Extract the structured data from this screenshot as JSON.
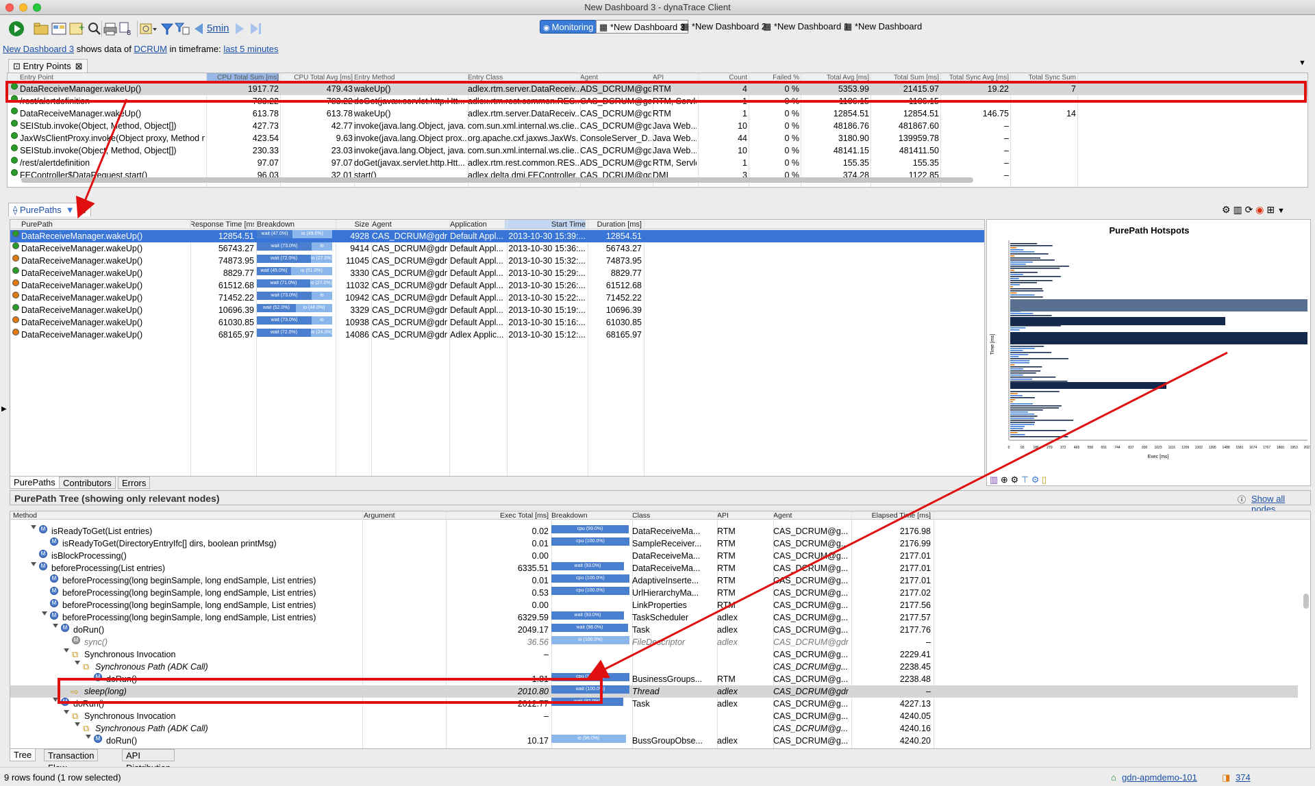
{
  "window": {
    "title": "New Dashboard 3 - dynaTrace Client"
  },
  "toolbar": {
    "time_label": "5min",
    "monitoring": "Monitoring",
    "dash_tabs": [
      "*New Dashboard 3",
      "*New Dashboard 2",
      "*New Dashboard 1",
      "*New Dashboard"
    ]
  },
  "info": {
    "dashboard": "New Dashboard 3",
    "shows": "shows data of",
    "source": "DCRUM",
    "in_tf": "in timeframe:",
    "timeframe": "last 5 minutes"
  },
  "entry_points": {
    "tab": "Entry Points",
    "columns": [
      "Entry Point",
      "CPU Total Sum [ms]",
      "CPU Total Avg [ms]",
      "Entry Method",
      "Entry Class",
      "Agent",
      "API",
      "Count",
      "Failed %",
      "Total Avg [ms]",
      "Total Sum [ms]",
      "Total Sync Avg [ms]",
      "Total Sync Sum"
    ],
    "rows": [
      [
        "DataReceiveManager.wakeUp()",
        "1917.72",
        "479.43",
        "wakeUp()",
        "adlex.rtm.server.DataReceiv...",
        "ADS_DCRUM@gd...",
        "RTM",
        "4",
        "0 %",
        "5353.99",
        "21415.97",
        "19.22",
        "7"
      ],
      [
        "/rest/alertdefinition",
        "783.22",
        "783.22",
        "doGet(javax.servlet.http.Htt...",
        "adlex.rtm.rest.common.RES...",
        "CAS_DCRUM@gd...",
        "RTM, Servlet",
        "1",
        "0 %",
        "1106.15",
        "1106.15",
        "–",
        ""
      ],
      [
        "DataReceiveManager.wakeUp()",
        "613.78",
        "613.78",
        "wakeUp()",
        "adlex.rtm.server.DataReceiv...",
        "CAS_DCRUM@gd...",
        "RTM",
        "1",
        "0 %",
        "12854.51",
        "12854.51",
        "146.75",
        "14"
      ],
      [
        "SEIStub.invoke(Object, Method, Object[])",
        "427.73",
        "42.77",
        "invoke(java.lang.Object, java....",
        "com.sun.xml.internal.ws.clie...",
        "CAS_DCRUM@gd...",
        "Java Web...",
        "10",
        "0 %",
        "48186.76",
        "481867.60",
        "–",
        ""
      ],
      [
        "JaxWsClientProxy.invoke(Object proxy, Method m...",
        "423.54",
        "9.63",
        "invoke(java.lang.Object prox...",
        "org.apache.cxf.jaxws.JaxWs...",
        "ConsoleServer_D...",
        "Java Web...",
        "44",
        "0 %",
        "3180.90",
        "139959.78",
        "–",
        ""
      ],
      [
        "SEIStub.invoke(Object, Method, Object[])",
        "230.33",
        "23.03",
        "invoke(java.lang.Object, java....",
        "com.sun.xml.internal.ws.clie...",
        "CAS_DCRUM@gd...",
        "Java Web...",
        "10",
        "0 %",
        "48141.15",
        "481411.50",
        "–",
        ""
      ],
      [
        "/rest/alertdefinition",
        "97.07",
        "97.07",
        "doGet(javax.servlet.http.Htt...",
        "adlex.rtm.rest.common.RES...",
        "ADS_DCRUM@gd...",
        "RTM, Servlet",
        "1",
        "0 %",
        "155.35",
        "155.35",
        "–",
        ""
      ],
      [
        "FEController$DataRequest.start()",
        "96.03",
        "32.01",
        "start()",
        "adlex.delta.dmi.FEController...",
        "CAS_DCRUM@gd...",
        "DMI",
        "3",
        "0 %",
        "374.28",
        "1122.85",
        "–",
        ""
      ]
    ]
  },
  "purepaths": {
    "tab": "PurePaths",
    "columns": [
      "PurePath",
      "Response Time [ms]",
      "Breakdown",
      "Size",
      "Agent",
      "Application",
      "Start Time",
      "Duration [ms]"
    ],
    "rows": [
      {
        "name": "DataReceiveManager.wakeUp()",
        "rt": "12854.51",
        "b1": "wait (47.0%)",
        "b2": "io (49.0%)",
        "size": "4928",
        "agent": "CAS_DCRUM@gdn-...",
        "app": "Default Appl...",
        "start": "2013-10-30 15:39:...",
        "dur": "12854.51",
        "color": "#2a9a2a"
      },
      {
        "name": "DataReceiveManager.wakeUp()",
        "rt": "56743.27",
        "b1": "wait (73.0%)",
        "b2": "io",
        "size": "9414",
        "agent": "CAS_DCRUM@gdn-...",
        "app": "Default Appl...",
        "start": "2013-10-30 15:36:...",
        "dur": "56743.27",
        "color": "#2a9a2a"
      },
      {
        "name": "DataReceiveManager.wakeUp()",
        "rt": "74873.95",
        "b1": "wait (72.0%)",
        "b2": "io (27.0%)",
        "size": "11045",
        "agent": "CAS_DCRUM@gdn-...",
        "app": "Default Appl...",
        "start": "2013-10-30 15:32:...",
        "dur": "74873.95",
        "color": "#e07a10"
      },
      {
        "name": "DataReceiveManager.wakeUp()",
        "rt": "8829.77",
        "b1": "wait (45.0%)",
        "b2": "io (51.0%)",
        "size": "3330",
        "agent": "CAS_DCRUM@gdn-...",
        "app": "Default Appl...",
        "start": "2013-10-30 15:29:...",
        "dur": "8829.77",
        "color": "#2a9a2a"
      },
      {
        "name": "DataReceiveManager.wakeUp()",
        "rt": "61512.68",
        "b1": "wait (71.0%)",
        "b2": "io (27.0%)",
        "size": "11032",
        "agent": "CAS_DCRUM@gdn-...",
        "app": "Default Appl...",
        "start": "2013-10-30 15:26:...",
        "dur": "61512.68",
        "color": "#e07a10"
      },
      {
        "name": "DataReceiveManager.wakeUp()",
        "rt": "71452.22",
        "b1": "wait (73.0%)",
        "b2": "io",
        "size": "10942",
        "agent": "CAS_DCRUM@gdn-...",
        "app": "Default Appl...",
        "start": "2013-10-30 15:22:...",
        "dur": "71452.22",
        "color": "#e07a10"
      },
      {
        "name": "DataReceiveManager.wakeUp()",
        "rt": "10696.39",
        "b1": "wait (52.0%)",
        "b2": "io (44.0%)",
        "size": "3329",
        "agent": "CAS_DCRUM@gdn-...",
        "app": "Default Appl...",
        "start": "2013-10-30 15:19:...",
        "dur": "10696.39",
        "color": "#2a9a2a"
      },
      {
        "name": "DataReceiveManager.wakeUp()",
        "rt": "61030.85",
        "b1": "wait (73.0%)",
        "b2": "io",
        "size": "10938",
        "agent": "CAS_DCRUM@gdn-...",
        "app": "Default Appl...",
        "start": "2013-10-30 15:16:...",
        "dur": "61030.85",
        "color": "#e07a10"
      },
      {
        "name": "DataReceiveManager.wakeUp()",
        "rt": "68165.97",
        "b1": "wait (72.0%)",
        "b2": "io (24.0%)",
        "size": "14086",
        "agent": "CAS_DCRUM@gdn-...",
        "app": "Adlex Applic...",
        "start": "2013-10-30 15:12:...",
        "dur": "68165.97",
        "color": "#e07a10"
      }
    ],
    "subtabs": [
      "PurePaths",
      "Contributors",
      "Errors"
    ]
  },
  "hotspots": {
    "title": "PurePath Hotspots",
    "ylabel": "Time [ms]",
    "xlabel": "Exec [ms]",
    "xticks": [
      "0",
      "93",
      "186",
      "279",
      "372",
      "465",
      "558",
      "651",
      "744",
      "837",
      "930",
      "1023",
      "1116",
      "1209",
      "1302",
      "1395",
      "1488",
      "1581",
      "1674",
      "1767",
      "1860",
      "1953",
      "2027"
    ]
  },
  "tree": {
    "title": "PurePath Tree (showing only relevant nodes)",
    "show_all": "Show all nodes",
    "columns": [
      "Method",
      "Argument",
      "Exec Total [ms]",
      "Breakdown",
      "Class",
      "API",
      "Agent",
      "Elapsed Time [ms]"
    ],
    "rows": [
      {
        "ind": 2,
        "m": "isReadyToGet(List entries)",
        "exec": "0.02",
        "bk": "cpu (99.0%)",
        "cls": "DataReceiveMa...",
        "api": "RTM",
        "agent": "CAS_DCRUM@g...",
        "el": "2176.98",
        "exp": 1,
        "ic": "m"
      },
      {
        "ind": 3,
        "m": "isReadyToGet(DirectoryEntryIfc[] dirs, boolean printMsg)",
        "exec": "0.01",
        "bk": "cpu (100.0%)",
        "cls": "SampleReceiver...",
        "api": "RTM",
        "agent": "CAS_DCRUM@g...",
        "el": "2176.99",
        "exp": 0,
        "ic": "m"
      },
      {
        "ind": 2,
        "m": "isBlockProcessing()",
        "exec": "0.00",
        "bk": "",
        "cls": "DataReceiveMa...",
        "api": "RTM",
        "agent": "CAS_DCRUM@g...",
        "el": "2177.01",
        "exp": 0,
        "ic": "m"
      },
      {
        "ind": 2,
        "m": "beforeProcessing(List entries)",
        "exec": "6335.51",
        "bk": "wait (93.0%)",
        "cls": "DataReceiveMa...",
        "api": "RTM",
        "agent": "CAS_DCRUM@g...",
        "el": "2177.01",
        "exp": 1,
        "ic": "m"
      },
      {
        "ind": 3,
        "m": "beforeProcessing(long beginSample, long endSample, List entries)",
        "exec": "0.01",
        "bk": "cpu (100.0%)",
        "cls": "AdaptiveInserte...",
        "api": "RTM",
        "agent": "CAS_DCRUM@g...",
        "el": "2177.01",
        "exp": 0,
        "ic": "m"
      },
      {
        "ind": 3,
        "m": "beforeProcessing(long beginSample, long endSample, List entries)",
        "exec": "0.53",
        "bk": "cpu (100.0%)",
        "cls": "UrlHierarchyMa...",
        "api": "RTM",
        "agent": "CAS_DCRUM@g...",
        "el": "2177.02",
        "exp": 0,
        "ic": "m"
      },
      {
        "ind": 3,
        "m": "beforeProcessing(long beginSample, long endSample, List entries)",
        "exec": "0.00",
        "bk": "",
        "cls": "LinkProperties",
        "api": "RTM",
        "agent": "CAS_DCRUM@g...",
        "el": "2177.56",
        "exp": 0,
        "ic": "m"
      },
      {
        "ind": 3,
        "m": "beforeProcessing(long beginSample, long endSample, List entries)",
        "exec": "6329.59",
        "bk": "wait (93.0%)",
        "cls": "TaskScheduler",
        "api": "adlex",
        "agent": "CAS_DCRUM@g...",
        "el": "2177.57",
        "exp": 1,
        "ic": "m"
      },
      {
        "ind": 4,
        "m": "doRun()",
        "exec": "2049.17",
        "bk": "wait (98.0%)",
        "cls": "Task",
        "api": "adlex",
        "agent": "CAS_DCRUM@g...",
        "el": "2177.76",
        "exp": 1,
        "ic": "m"
      },
      {
        "ind": 5,
        "m": "sync()",
        "exec": "36.56",
        "bk": "io (100.0%)",
        "cls": "FileDescriptor",
        "api": "adlex",
        "agent": "CAS_DCRUM@gdn-",
        "el": "–",
        "exp": 0,
        "ic": "g",
        "it": 1
      },
      {
        "ind": 5,
        "m": "Synchronous Invocation",
        "exec": "–",
        "bk": "",
        "cls": "",
        "api": "",
        "agent": "CAS_DCRUM@g...",
        "el": "2229.41",
        "exp": 1,
        "ic": "s"
      },
      {
        "ind": 6,
        "m": "Synchronous Path (ADK Call)",
        "exec": "",
        "bk": "",
        "cls": "",
        "api": "",
        "agent": "CAS_DCRUM@g...",
        "el": "2238.45",
        "exp": 1,
        "ic": "s",
        "it": 1
      },
      {
        "ind": 7,
        "m": "doRun()",
        "exec": "1.81",
        "bk": "cpu (100.0%)",
        "cls": "BusinessGroups...",
        "api": "RTM",
        "agent": "CAS_DCRUM@g...",
        "el": "2238.48",
        "exp": 0,
        "ic": "m"
      },
      {
        "ind": 5,
        "m": "sleep(long)",
        "exec": "2010.80",
        "bk": "wait (100.0%)",
        "cls": "Thread",
        "api": "adlex",
        "agent": "CAS_DCRUM@gdn-",
        "el": "–",
        "exp": 0,
        "ic": "a",
        "it": 1,
        "sel": 1
      },
      {
        "ind": 4,
        "m": "doRun()",
        "exec": "2012.77",
        "bk": "wait (92.0%)",
        "cls": "Task",
        "api": "adlex",
        "agent": "CAS_DCRUM@g...",
        "el": "4227.13",
        "exp": 1,
        "ic": "m"
      },
      {
        "ind": 5,
        "m": "Synchronous Invocation",
        "exec": "–",
        "bk": "",
        "cls": "",
        "api": "",
        "agent": "CAS_DCRUM@g...",
        "el": "4240.05",
        "exp": 1,
        "ic": "s"
      },
      {
        "ind": 6,
        "m": "Synchronous Path (ADK Call)",
        "exec": "",
        "bk": "",
        "cls": "",
        "api": "",
        "agent": "CAS_DCRUM@g...",
        "el": "4240.16",
        "exp": 1,
        "ic": "s",
        "it": 1
      },
      {
        "ind": 7,
        "m": "doRun()",
        "exec": "10.17",
        "bk": "io (96.0%)",
        "cls": "BussGroupObse...",
        "api": "adlex",
        "agent": "CAS_DCRUM@g...",
        "el": "4240.20",
        "exp": 1,
        "ic": "m"
      }
    ],
    "subtabs": [
      "Tree",
      "Transaction Flow",
      "API Distribution"
    ]
  },
  "status": {
    "left": "9 rows found (1 row selected)",
    "server": "gdn-apmdemo-101",
    "count": "374"
  },
  "colors": {
    "accent": "#3875d7",
    "red": "#e01010",
    "bar_dark": "#14284a",
    "bar_blue": "#3a7bd5"
  }
}
